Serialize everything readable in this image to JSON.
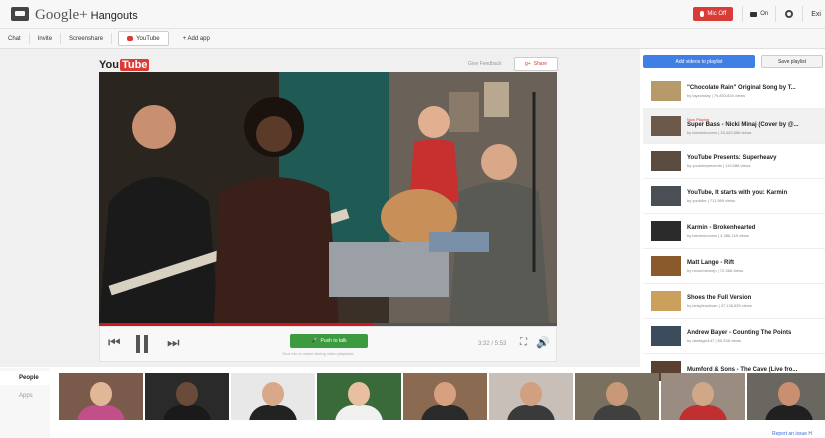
{
  "topbar": {
    "brand": "Google+",
    "app": "Hangouts",
    "mic_label": "Mic Off",
    "cam_label": "On",
    "exit_label": "Exi"
  },
  "tabs": [
    {
      "label": "Chat"
    },
    {
      "label": "Invite"
    },
    {
      "label": "Screenshare"
    },
    {
      "label": "YouTube",
      "active": true
    },
    {
      "label": "+ Add app"
    }
  ],
  "player": {
    "logo_you": "You",
    "logo_tube": "Tube",
    "feedback": "Give Feedback",
    "share": "Share",
    "push_to_talk": "Push to talk",
    "mute_note": "Your mic is muted during video playback",
    "time": "3:32 / 5:53",
    "progress": 0.6
  },
  "playlist": {
    "add_button": "Add videos to playlist",
    "save_button": "Save playlist",
    "now_playing_label": "Now Playing",
    "items": [
      {
        "title": "\"Chocolate Rain\" Original Song by T...",
        "by": "by tayzonday | 79,803,834 views",
        "color": "#b79a6a"
      },
      {
        "title": "Super Bass - Nicki Minaj (Cover by @...",
        "by": "by karminicovers | 15,420,656 views",
        "color": "#6b5a4b",
        "now": true
      },
      {
        "title": "YouTube Presents: Superheavy",
        "by": "by youtubepresents | 119,088 views",
        "color": "#5b4a3e"
      },
      {
        "title": "YouTube, It starts with you: Karmin",
        "by": "by youtube | 711,989 views",
        "color": "#4a4f55"
      },
      {
        "title": "Karmin - Brokenhearted",
        "by": "by karminicovers | 4,386,118 views",
        "color": "#2b2b2b"
      },
      {
        "title": "Matt Lange - Rift",
        "by": "by mrcuriosheep | 72,366 views",
        "color": "#8a5a2c"
      },
      {
        "title": "Shoes the Full Version",
        "by": "by lankyleoulivan | 47,136,835 views",
        "color": "#caa05c"
      },
      {
        "title": "Andrew Bayer - Counting The Points",
        "by": "by dantagio147 | 60,338 views",
        "color": "#3c4c5c"
      },
      {
        "title": "Mumford & Sons - The Cave (Live fro...",
        "by": "",
        "color": "#5a4030"
      }
    ]
  },
  "leftnav": {
    "people": "People",
    "apps": "Apps"
  },
  "participants": [
    {
      "bg": "#7a5a4a",
      "skin": "#e0b898",
      "shirt": "#c34f8a"
    },
    {
      "bg": "#2a2a2a",
      "skin": "#6a4a38",
      "shirt": "#1a1a1a"
    },
    {
      "bg": "#e8e8e8",
      "skin": "#d9a88a",
      "shirt": "#222222"
    },
    {
      "bg": "#3a6a3a",
      "skin": "#e8c0a0",
      "shirt": "#f0f0f0"
    },
    {
      "bg": "#8a6a50",
      "skin": "#d8a080",
      "shirt": "#2a2a2a"
    },
    {
      "bg": "#c8c0b8",
      "skin": "#d0a080",
      "shirt": "#3a3a3a"
    },
    {
      "bg": "#7a7060",
      "skin": "#c89878",
      "shirt": "#404040"
    },
    {
      "bg": "#9a8c80",
      "skin": "#d0a888",
      "shirt": "#c03030"
    },
    {
      "bg": "#6a6660",
      "skin": "#c89070",
      "shirt": "#202020"
    }
  ],
  "footer": {
    "report": "Report an issue",
    "help": "H"
  }
}
